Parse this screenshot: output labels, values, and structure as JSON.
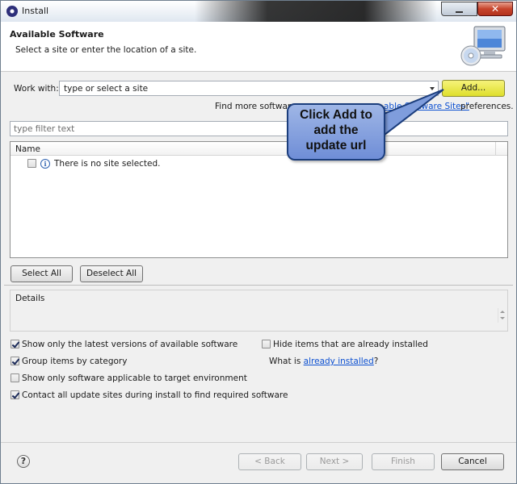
{
  "window": {
    "title": "Install"
  },
  "header": {
    "title": "Available Software",
    "description": "Select a site or enter the location of a site."
  },
  "work_with": {
    "label": "Work with:",
    "value": "type or select a site",
    "add_button": "Add..."
  },
  "find_more": {
    "prefix": "Find more software",
    "link": "able Software Sites\"",
    "suffix": "preferences."
  },
  "filter": {
    "placeholder": "type filter text"
  },
  "tree": {
    "column_header": "Name",
    "rows": [
      {
        "label": "There is no site selected.",
        "checked": false
      }
    ]
  },
  "buttons": {
    "select_all": "Select All",
    "deselect_all": "Deselect All"
  },
  "details": {
    "label": "Details"
  },
  "options": {
    "latest_versions": "Show only the latest versions of available software",
    "hide_installed": "Hide items that are already installed",
    "group_by_category": "Group items by category",
    "what_is_prefix": "What is",
    "what_is_link": "already installed",
    "what_is_suffix": "?",
    "applicable_target": "Show only software applicable to target environment",
    "contact_sites": "Contact all update sites during install to find required software"
  },
  "footer": {
    "back": "< Back",
    "next": "Next >",
    "finish": "Finish",
    "cancel": "Cancel"
  },
  "callout": {
    "line1": "Click Add to",
    "line2": "add the",
    "line3": "update url"
  },
  "icons": {
    "app": "eclipse-icon",
    "header": "computer-cd-icon",
    "info": "info-icon",
    "help": "help-icon"
  }
}
